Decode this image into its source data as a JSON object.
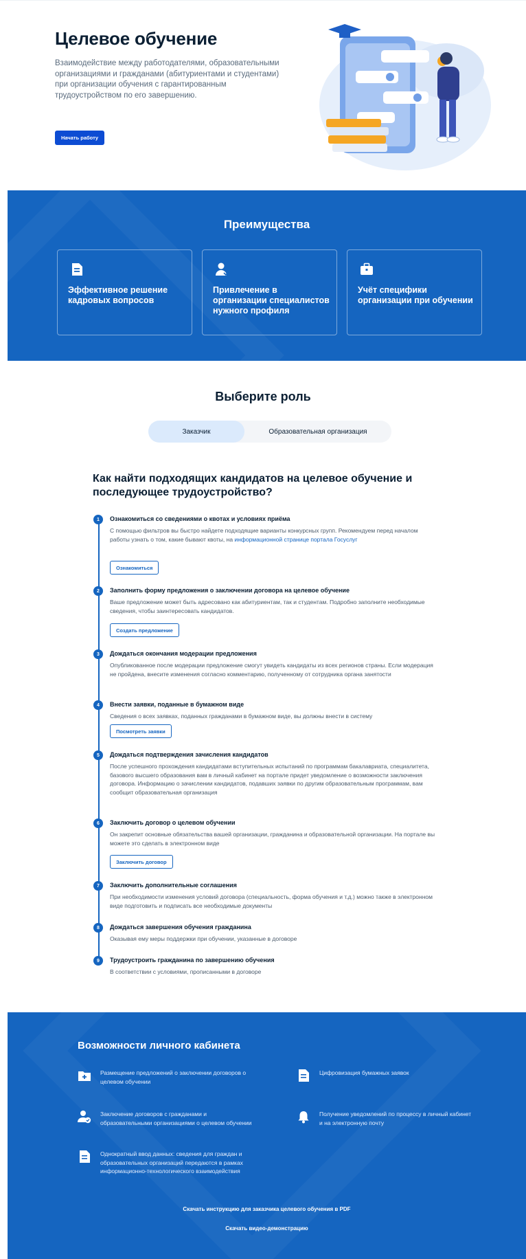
{
  "hero": {
    "title": "Целевое обучение",
    "description": "Взаимодействие между работодателями, образовательными организациями и гражданами (абитуриентами и студентами) при организации обучения с гарантированным трудоустройством по его завершению.",
    "start_button": "Начать работу"
  },
  "advantages": {
    "title": "Преимущества",
    "cards": [
      {
        "label": "Эффективное решение кадровых вопросов",
        "icon": "document-icon"
      },
      {
        "label": "Привлечение в организации специалистов нужного профиля",
        "icon": "user-icon"
      },
      {
        "label": "Учёт специфики организации при обучении",
        "icon": "briefcase-icon"
      }
    ]
  },
  "role": {
    "title": "Выберите роль",
    "tabs": [
      "Заказчик",
      "Образовательная организация"
    ],
    "active_tab": "Заказчик"
  },
  "steps": {
    "title": "Как найти подходящих кандидатов на целевое обучение и последующее трудоустройство?",
    "items": [
      {
        "num": "1",
        "title": "Ознакомиться со сведениями о квотах и условиях приёма",
        "desc": "С помощью фильтров вы быстро найдете подходящие варианты конкурсных групп. Рекомендуем перед началом работы узнать о том, какие бывают квоты, на ",
        "link": "информационной странице портала Госуслуг",
        "button": "Ознакомиться"
      },
      {
        "num": "2",
        "title": "Заполнить форму предложения о заключении договора на целевое обучение",
        "desc": "Ваше предложение может быть адресовано как абитуриентам, так и студентам. Подробно заполните необходимые сведения, чтобы заинтересовать кандидатов.",
        "button": "Создать предложение"
      },
      {
        "num": "3",
        "title": "Дождаться окончания модерации предложения",
        "desc": "Опубликованное после модерации предложение смогут увидеть кандидаты из всех регионов страны. Если модерация не пройдена, внесите изменения согласно комментарию, полученному от сотрудника органа занятости"
      },
      {
        "num": "4",
        "title": "Внести заявки, поданные в бумажном виде",
        "desc": "Сведения о всех заявках, поданных гражданами в бумажном виде, вы должны внести в систему",
        "button": "Посмотреть заявки"
      },
      {
        "num": "5",
        "title": "Дождаться подтверждения зачисления кандидатов",
        "desc": "После успешного прохождения кандидатами вступительных испытаний по программам бакалавриата, специалитета, базового высшего образования вам в личный кабинет на портале придет уведомление о возможности заключения договора. Информацию о зачислении кандидатов, подавших заявки по другим образовательным программам, вам сообщит образовательная организация"
      },
      {
        "num": "6",
        "title": "Заключить договор о целевом обучении",
        "desc": "Он закрепит основные обязательства вашей организации, гражданина и образовательной организации. На портале вы можете это сделать в электронном виде",
        "button": "Заключить договор"
      },
      {
        "num": "7",
        "title": "Заключить дополнительные соглашения",
        "desc": "При необходимости изменения условий договора (специальность, форма обучения и т.д.) можно также в электронном виде подготовить и подписать все необходимые документы"
      },
      {
        "num": "8",
        "title": "Дождаться завершения обучения гражданина",
        "desc": "Оказывая ему меры поддержки при обучении, указанные в договоре"
      },
      {
        "num": "9",
        "title": "Трудоустроить гражданина по завершению обучения",
        "desc": "В соответствии с условиями, прописанными в договоре"
      }
    ]
  },
  "cabinet": {
    "title": "Возможности личного кабинета",
    "features": [
      {
        "text": "Размещение предложений о заключении договоров о целевом обучении",
        "icon": "folder-plus-icon"
      },
      {
        "text": "Цифровизация бумажных заявок",
        "icon": "document-icon"
      },
      {
        "text": "Заключение договоров с гражданами и образовательными организациями о целевом обучении",
        "icon": "user-check-icon"
      },
      {
        "text": "Получение уведомлений по процессу в личный кабинет и на электронную почту",
        "icon": "bell-icon"
      },
      {
        "text": "Однократный ввод данных: сведения для граждан и образовательных организаций передаются в рамках информационно-технологического взаимодействия",
        "icon": "document-icon"
      }
    ],
    "download_link": "Скачать инструкцию для заказчика целевого обучения в PDF",
    "video_link": "Скачать видео-демонстрацию"
  },
  "colors": {
    "primary": "#1565c0",
    "button": "#0d4cd3",
    "accent_orange": "#f5a623"
  }
}
